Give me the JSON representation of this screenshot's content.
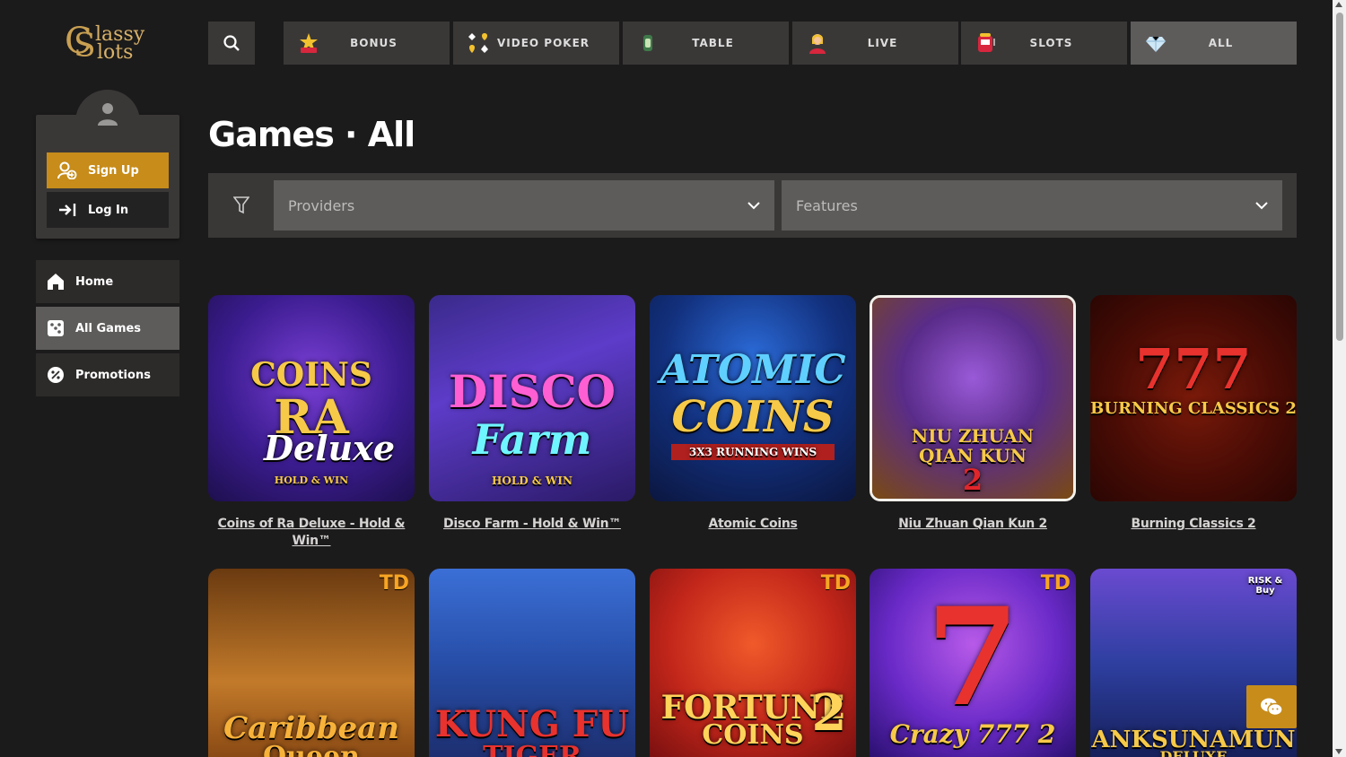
{
  "brand": {
    "logo_cap": "C",
    "logo_cap2": "S",
    "logo_line1": "lassy",
    "logo_line2": "lots"
  },
  "account": {
    "signup_label": "Sign Up",
    "login_label": "Log In"
  },
  "sidebar": {
    "items": [
      {
        "label": "Home",
        "icon": "home-icon"
      },
      {
        "label": "All Games",
        "icon": "dice-icon",
        "active": true
      },
      {
        "label": "Promotions",
        "icon": "percent-icon"
      }
    ]
  },
  "categories": [
    {
      "label": "BONUS",
      "icon": "star-burst-icon"
    },
    {
      "label": "VIDEO POKER",
      "icon": "card-suits-icon"
    },
    {
      "label": "TABLE",
      "icon": "chip-icon"
    },
    {
      "label": "LIVE",
      "icon": "dealer-icon"
    },
    {
      "label": "SLOTS",
      "icon": "slot-machine-icon"
    },
    {
      "label": "ALL",
      "icon": "diamond-icon",
      "active": true
    }
  ],
  "page": {
    "title": "Games · All"
  },
  "filters": {
    "providers_placeholder": "Providers",
    "features_placeholder": "Features"
  },
  "games": [
    {
      "title": "Coins of Ra Deluxe - Hold & Win™",
      "art_line1": "COINS",
      "art_line2": "RA",
      "art_line3": "Deluxe",
      "art_line4": "HOLD & WIN"
    },
    {
      "title": "Disco Farm - Hold & Win™",
      "art_line1": "DISCO",
      "art_line2": "Farm",
      "art_line3": "HOLD & WIN"
    },
    {
      "title": "Atomic Coins",
      "art_line1": "ATOMIC",
      "art_line2": "COINS",
      "art_line3": "3X3 RUNNING WINS"
    },
    {
      "title": "Niu Zhuan Qian Kun 2",
      "art_line1": "NIU ZHUAN",
      "art_line2": "QIAN KUN",
      "art_line3": "2"
    },
    {
      "title": "Burning Classics 2",
      "art_line1": "777",
      "art_line2": "BURNING CLASSICS 2"
    },
    {
      "title": "",
      "art_line1": "Caribbean",
      "art_line2": "Queen",
      "badge": "TD"
    },
    {
      "title": "",
      "art_line1": "KUNG FU",
      "art_line2": "TIGER"
    },
    {
      "title": "",
      "art_line1": "FORTUNE",
      "art_line2": "COINS",
      "art_line3": "2",
      "badge": "TD"
    },
    {
      "title": "",
      "art_line1": "7",
      "art_line2": "Crazy 777 2",
      "badge": "TD"
    },
    {
      "title": "",
      "art_line1": "ANKSUNAMUN",
      "art_line2": "DELUXE",
      "badge_small": "RISK & Buy"
    }
  ],
  "colors": {
    "accent": "#c78c1a",
    "background": "#1c1b1b",
    "panel": "#3a3837",
    "panel_active": "#5e5c5b"
  }
}
